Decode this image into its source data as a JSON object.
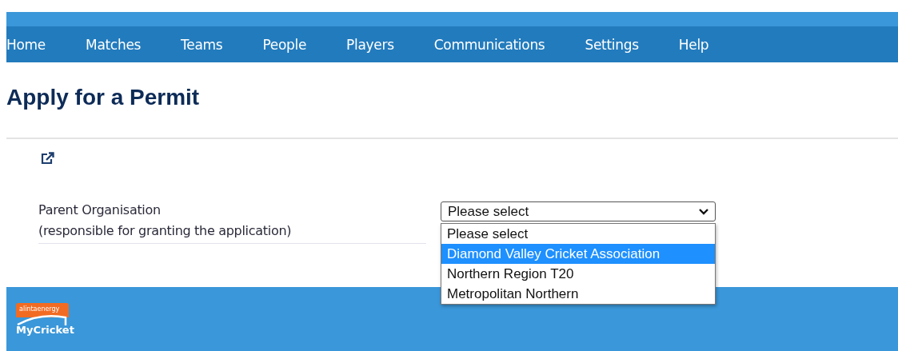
{
  "nav": [
    {
      "label": "Home"
    },
    {
      "label": "Matches"
    },
    {
      "label": "Teams"
    },
    {
      "label": "People"
    },
    {
      "label": "Players"
    },
    {
      "label": "Communications"
    },
    {
      "label": "Settings"
    },
    {
      "label": "Help"
    }
  ],
  "title": "Apply for a Permit",
  "form": {
    "label": "Parent Organisation",
    "sublabel": "(responsible for granting the application)",
    "select": {
      "value": "Please select",
      "expanded": true,
      "options": [
        {
          "label": "Please select",
          "highlighted": false
        },
        {
          "label": "Diamond Valley Cricket Association",
          "highlighted": true
        },
        {
          "label": "Northern Region T20",
          "highlighted": false
        },
        {
          "label": "Metropolitan Northern",
          "highlighted": false
        }
      ]
    }
  },
  "footer": {
    "logo_badge": "alintaenergy",
    "logo_text": "MyCricket"
  }
}
